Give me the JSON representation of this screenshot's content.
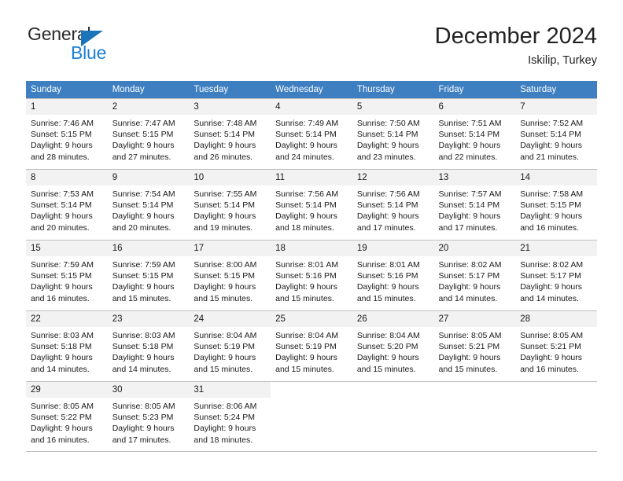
{
  "brand": {
    "name_dark": "General",
    "name_blue": "Blue",
    "triangle_icon": "triangle-icon",
    "accent_blue": "#1b7fd4",
    "header_blue": "#3d7fc1"
  },
  "header": {
    "title": "December 2024",
    "subtitle": "Iskilip, Turkey"
  },
  "calendar": {
    "weekday_headers": [
      "Sunday",
      "Monday",
      "Tuesday",
      "Wednesday",
      "Thursday",
      "Friday",
      "Saturday"
    ],
    "weeks": [
      [
        {
          "day": "1",
          "sunrise": "Sunrise: 7:46 AM",
          "sunset": "Sunset: 5:15 PM",
          "daylight_line1": "Daylight: 9 hours",
          "daylight_line2": "and 28 minutes."
        },
        {
          "day": "2",
          "sunrise": "Sunrise: 7:47 AM",
          "sunset": "Sunset: 5:15 PM",
          "daylight_line1": "Daylight: 9 hours",
          "daylight_line2": "and 27 minutes."
        },
        {
          "day": "3",
          "sunrise": "Sunrise: 7:48 AM",
          "sunset": "Sunset: 5:14 PM",
          "daylight_line1": "Daylight: 9 hours",
          "daylight_line2": "and 26 minutes."
        },
        {
          "day": "4",
          "sunrise": "Sunrise: 7:49 AM",
          "sunset": "Sunset: 5:14 PM",
          "daylight_line1": "Daylight: 9 hours",
          "daylight_line2": "and 24 minutes."
        },
        {
          "day": "5",
          "sunrise": "Sunrise: 7:50 AM",
          "sunset": "Sunset: 5:14 PM",
          "daylight_line1": "Daylight: 9 hours",
          "daylight_line2": "and 23 minutes."
        },
        {
          "day": "6",
          "sunrise": "Sunrise: 7:51 AM",
          "sunset": "Sunset: 5:14 PM",
          "daylight_line1": "Daylight: 9 hours",
          "daylight_line2": "and 22 minutes."
        },
        {
          "day": "7",
          "sunrise": "Sunrise: 7:52 AM",
          "sunset": "Sunset: 5:14 PM",
          "daylight_line1": "Daylight: 9 hours",
          "daylight_line2": "and 21 minutes."
        }
      ],
      [
        {
          "day": "8",
          "sunrise": "Sunrise: 7:53 AM",
          "sunset": "Sunset: 5:14 PM",
          "daylight_line1": "Daylight: 9 hours",
          "daylight_line2": "and 20 minutes."
        },
        {
          "day": "9",
          "sunrise": "Sunrise: 7:54 AM",
          "sunset": "Sunset: 5:14 PM",
          "daylight_line1": "Daylight: 9 hours",
          "daylight_line2": "and 20 minutes."
        },
        {
          "day": "10",
          "sunrise": "Sunrise: 7:55 AM",
          "sunset": "Sunset: 5:14 PM",
          "daylight_line1": "Daylight: 9 hours",
          "daylight_line2": "and 19 minutes."
        },
        {
          "day": "11",
          "sunrise": "Sunrise: 7:56 AM",
          "sunset": "Sunset: 5:14 PM",
          "daylight_line1": "Daylight: 9 hours",
          "daylight_line2": "and 18 minutes."
        },
        {
          "day": "12",
          "sunrise": "Sunrise: 7:56 AM",
          "sunset": "Sunset: 5:14 PM",
          "daylight_line1": "Daylight: 9 hours",
          "daylight_line2": "and 17 minutes."
        },
        {
          "day": "13",
          "sunrise": "Sunrise: 7:57 AM",
          "sunset": "Sunset: 5:14 PM",
          "daylight_line1": "Daylight: 9 hours",
          "daylight_line2": "and 17 minutes."
        },
        {
          "day": "14",
          "sunrise": "Sunrise: 7:58 AM",
          "sunset": "Sunset: 5:15 PM",
          "daylight_line1": "Daylight: 9 hours",
          "daylight_line2": "and 16 minutes."
        }
      ],
      [
        {
          "day": "15",
          "sunrise": "Sunrise: 7:59 AM",
          "sunset": "Sunset: 5:15 PM",
          "daylight_line1": "Daylight: 9 hours",
          "daylight_line2": "and 16 minutes."
        },
        {
          "day": "16",
          "sunrise": "Sunrise: 7:59 AM",
          "sunset": "Sunset: 5:15 PM",
          "daylight_line1": "Daylight: 9 hours",
          "daylight_line2": "and 15 minutes."
        },
        {
          "day": "17",
          "sunrise": "Sunrise: 8:00 AM",
          "sunset": "Sunset: 5:15 PM",
          "daylight_line1": "Daylight: 9 hours",
          "daylight_line2": "and 15 minutes."
        },
        {
          "day": "18",
          "sunrise": "Sunrise: 8:01 AM",
          "sunset": "Sunset: 5:16 PM",
          "daylight_line1": "Daylight: 9 hours",
          "daylight_line2": "and 15 minutes."
        },
        {
          "day": "19",
          "sunrise": "Sunrise: 8:01 AM",
          "sunset": "Sunset: 5:16 PM",
          "daylight_line1": "Daylight: 9 hours",
          "daylight_line2": "and 15 minutes."
        },
        {
          "day": "20",
          "sunrise": "Sunrise: 8:02 AM",
          "sunset": "Sunset: 5:17 PM",
          "daylight_line1": "Daylight: 9 hours",
          "daylight_line2": "and 14 minutes."
        },
        {
          "day": "21",
          "sunrise": "Sunrise: 8:02 AM",
          "sunset": "Sunset: 5:17 PM",
          "daylight_line1": "Daylight: 9 hours",
          "daylight_line2": "and 14 minutes."
        }
      ],
      [
        {
          "day": "22",
          "sunrise": "Sunrise: 8:03 AM",
          "sunset": "Sunset: 5:18 PM",
          "daylight_line1": "Daylight: 9 hours",
          "daylight_line2": "and 14 minutes."
        },
        {
          "day": "23",
          "sunrise": "Sunrise: 8:03 AM",
          "sunset": "Sunset: 5:18 PM",
          "daylight_line1": "Daylight: 9 hours",
          "daylight_line2": "and 14 minutes."
        },
        {
          "day": "24",
          "sunrise": "Sunrise: 8:04 AM",
          "sunset": "Sunset: 5:19 PM",
          "daylight_line1": "Daylight: 9 hours",
          "daylight_line2": "and 15 minutes."
        },
        {
          "day": "25",
          "sunrise": "Sunrise: 8:04 AM",
          "sunset": "Sunset: 5:19 PM",
          "daylight_line1": "Daylight: 9 hours",
          "daylight_line2": "and 15 minutes."
        },
        {
          "day": "26",
          "sunrise": "Sunrise: 8:04 AM",
          "sunset": "Sunset: 5:20 PM",
          "daylight_line1": "Daylight: 9 hours",
          "daylight_line2": "and 15 minutes."
        },
        {
          "day": "27",
          "sunrise": "Sunrise: 8:05 AM",
          "sunset": "Sunset: 5:21 PM",
          "daylight_line1": "Daylight: 9 hours",
          "daylight_line2": "and 15 minutes."
        },
        {
          "day": "28",
          "sunrise": "Sunrise: 8:05 AM",
          "sunset": "Sunset: 5:21 PM",
          "daylight_line1": "Daylight: 9 hours",
          "daylight_line2": "and 16 minutes."
        }
      ],
      [
        {
          "day": "29",
          "sunrise": "Sunrise: 8:05 AM",
          "sunset": "Sunset: 5:22 PM",
          "daylight_line1": "Daylight: 9 hours",
          "daylight_line2": "and 16 minutes."
        },
        {
          "day": "30",
          "sunrise": "Sunrise: 8:05 AM",
          "sunset": "Sunset: 5:23 PM",
          "daylight_line1": "Daylight: 9 hours",
          "daylight_line2": "and 17 minutes."
        },
        {
          "day": "31",
          "sunrise": "Sunrise: 8:06 AM",
          "sunset": "Sunset: 5:24 PM",
          "daylight_line1": "Daylight: 9 hours",
          "daylight_line2": "and 18 minutes."
        },
        {
          "day": "",
          "sunrise": "",
          "sunset": "",
          "daylight_line1": "",
          "daylight_line2": ""
        },
        {
          "day": "",
          "sunrise": "",
          "sunset": "",
          "daylight_line1": "",
          "daylight_line2": ""
        },
        {
          "day": "",
          "sunrise": "",
          "sunset": "",
          "daylight_line1": "",
          "daylight_line2": ""
        },
        {
          "day": "",
          "sunrise": "",
          "sunset": "",
          "daylight_line1": "",
          "daylight_line2": ""
        }
      ]
    ]
  }
}
